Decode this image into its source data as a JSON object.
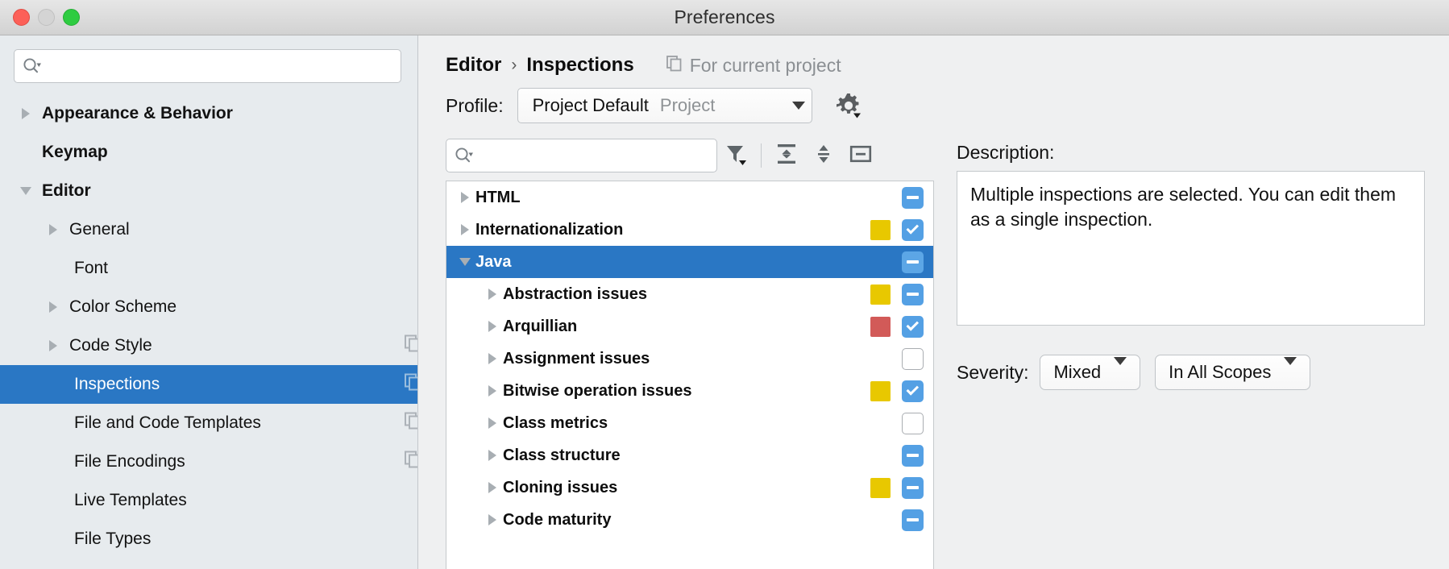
{
  "window": {
    "title": "Preferences",
    "traffic_lights": [
      "close",
      "minimize",
      "maximize"
    ]
  },
  "sidebar": {
    "search": {
      "value": "",
      "placeholder": ""
    },
    "items": [
      {
        "label": "Appearance & Behavior",
        "level": 0,
        "arrow": "right",
        "bold": true,
        "selected": false,
        "copy_icon": false
      },
      {
        "label": "Keymap",
        "level": 0,
        "arrow": "none",
        "bold": true,
        "selected": false,
        "copy_icon": false
      },
      {
        "label": "Editor",
        "level": 0,
        "arrow": "down",
        "bold": true,
        "selected": false,
        "copy_icon": false
      },
      {
        "label": "General",
        "level": 1,
        "arrow": "right",
        "bold": false,
        "selected": false,
        "copy_icon": false
      },
      {
        "label": "Font",
        "level": 1,
        "arrow": "none",
        "bold": false,
        "selected": false,
        "copy_icon": false
      },
      {
        "label": "Color Scheme",
        "level": 1,
        "arrow": "right",
        "bold": false,
        "selected": false,
        "copy_icon": false
      },
      {
        "label": "Code Style",
        "level": 1,
        "arrow": "right",
        "bold": false,
        "selected": false,
        "copy_icon": true
      },
      {
        "label": "Inspections",
        "level": 1,
        "arrow": "none",
        "bold": false,
        "selected": true,
        "copy_icon": true
      },
      {
        "label": "File and Code Templates",
        "level": 1,
        "arrow": "none",
        "bold": false,
        "selected": false,
        "copy_icon": true
      },
      {
        "label": "File Encodings",
        "level": 1,
        "arrow": "none",
        "bold": false,
        "selected": false,
        "copy_icon": true
      },
      {
        "label": "Live Templates",
        "level": 1,
        "arrow": "none",
        "bold": false,
        "selected": false,
        "copy_icon": false
      },
      {
        "label": "File Types",
        "level": 1,
        "arrow": "none",
        "bold": false,
        "selected": false,
        "copy_icon": false
      }
    ]
  },
  "header": {
    "breadcrumb": {
      "parent": "Editor",
      "separator": "›",
      "current": "Inspections"
    },
    "scope_note": "For current project",
    "scope_icon": "copy-icon"
  },
  "profile": {
    "label": "Profile:",
    "value_main": "Project Default",
    "value_sub": "Project",
    "dropdown_icon": "chevron-down-icon",
    "gear_icon": "gear-icon"
  },
  "toolbar": {
    "search": {
      "value": "",
      "placeholder": ""
    },
    "buttons": [
      {
        "name": "filter-button",
        "icon": "filter-icon"
      },
      {
        "name": "expand-all-button",
        "icon": "expand-all-icon"
      },
      {
        "name": "collapse-all-button",
        "icon": "collapse-all-icon"
      },
      {
        "name": "reset-button",
        "icon": "minus-box-icon"
      }
    ]
  },
  "tree": {
    "rows": [
      {
        "label": "HTML",
        "level": 0,
        "arrow": "right",
        "selected": false,
        "severity": null,
        "check": "partial"
      },
      {
        "label": "Internationalization",
        "level": 0,
        "arrow": "right",
        "selected": false,
        "severity": "#e8c800",
        "check": "checked"
      },
      {
        "label": "Java",
        "level": 0,
        "arrow": "down",
        "selected": true,
        "severity": null,
        "check": "partial"
      },
      {
        "label": "Abstraction issues",
        "level": 1,
        "arrow": "right",
        "selected": false,
        "severity": "#e8c800",
        "check": "partial"
      },
      {
        "label": "Arquillian",
        "level": 1,
        "arrow": "right",
        "selected": false,
        "severity": "#d25a58",
        "check": "checked"
      },
      {
        "label": "Assignment issues",
        "level": 1,
        "arrow": "right",
        "selected": false,
        "severity": null,
        "check": "unchecked"
      },
      {
        "label": "Bitwise operation issues",
        "level": 1,
        "arrow": "right",
        "selected": false,
        "severity": "#e8c800",
        "check": "checked"
      },
      {
        "label": "Class metrics",
        "level": 1,
        "arrow": "right",
        "selected": false,
        "severity": null,
        "check": "unchecked"
      },
      {
        "label": "Class structure",
        "level": 1,
        "arrow": "right",
        "selected": false,
        "severity": null,
        "check": "partial"
      },
      {
        "label": "Cloning issues",
        "level": 1,
        "arrow": "right",
        "selected": false,
        "severity": "#e8c800",
        "check": "partial"
      },
      {
        "label": "Code maturity",
        "level": 1,
        "arrow": "right",
        "selected": false,
        "severity": null,
        "check": "partial"
      }
    ]
  },
  "details": {
    "description_label": "Description:",
    "description_text": "Multiple inspections are selected. You can edit them as a single inspection.",
    "severity_label": "Severity:",
    "severity_value": "Mixed",
    "scope_value": "In All Scopes"
  },
  "colors": {
    "selection_blue": "#2a77c4",
    "checkbox_blue": "#54a0e4",
    "severity_warning": "#e8c800",
    "severity_error": "#d25a58",
    "sidebar_bg": "#e7ebee",
    "pane_bg": "#eff0f1"
  }
}
